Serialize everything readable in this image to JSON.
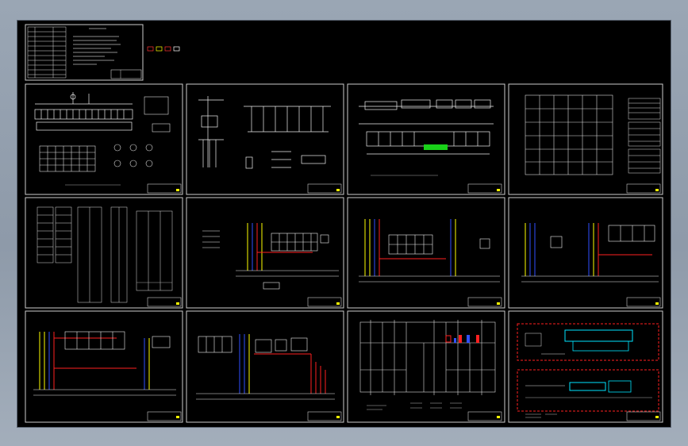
{
  "drawing_set": {
    "sheets": [
      {
        "id": "cover",
        "kind": "index table + general notes",
        "has_title_block": true
      },
      {
        "id": "sheet-1",
        "kind": "switchgear single-line diagram",
        "has_title_block": true
      },
      {
        "id": "sheet-2",
        "kind": "distribution system diagram",
        "has_title_block": true
      },
      {
        "id": "sheet-3",
        "kind": "panel schematic",
        "has_title_block": true
      },
      {
        "id": "sheet-4",
        "kind": "panel grid + schedules",
        "has_title_block": true
      },
      {
        "id": "sheet-5",
        "kind": "cable / equipment schedules",
        "has_title_block": true
      },
      {
        "id": "sheet-6",
        "kind": "control wiring diagram",
        "has_title_block": true
      },
      {
        "id": "sheet-7",
        "kind": "control wiring diagram",
        "has_title_block": true
      },
      {
        "id": "sheet-8",
        "kind": "control wiring diagram",
        "has_title_block": true
      },
      {
        "id": "sheet-9",
        "kind": "control wiring diagram",
        "has_title_block": true
      },
      {
        "id": "sheet-10",
        "kind": "control wiring diagram",
        "has_title_block": true
      },
      {
        "id": "sheet-11",
        "kind": "floor plan",
        "has_title_block": true
      },
      {
        "id": "sheet-12",
        "kind": "floor plan (red/cyan layers)",
        "has_title_block": true
      }
    ],
    "colors": {
      "background": "#000000",
      "linework": "#ffffff",
      "layer_yellow": "#ffff00",
      "layer_red": "#ff2020",
      "layer_blue": "#3050ff",
      "layer_cyan": "#00e5ff",
      "layer_green": "#19d219",
      "layer_magenta": "#ff30ff",
      "frame": "#c8c8c8"
    }
  }
}
